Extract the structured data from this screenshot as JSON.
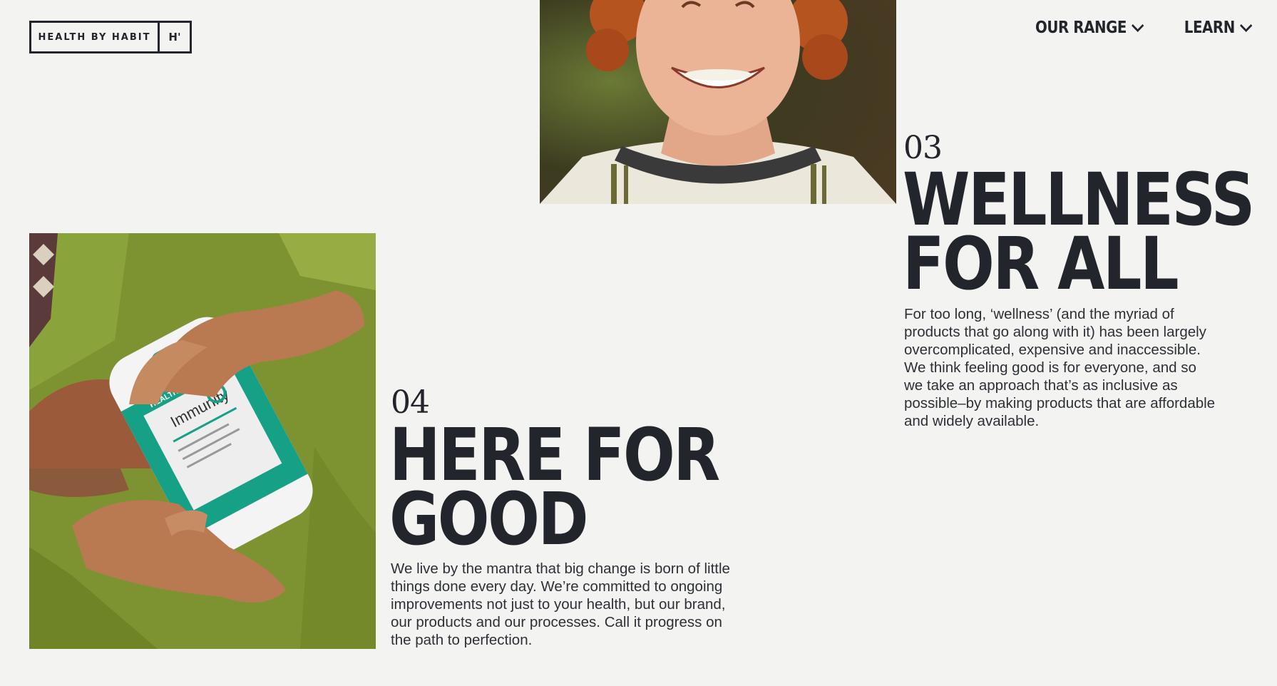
{
  "header": {
    "logo_text": "HEALTH BY HABIT",
    "logo_mark": "H'",
    "nav": [
      {
        "label": "OUR RANGE",
        "icon": "chevron-down-icon"
      },
      {
        "label": "LEARN",
        "icon": "chevron-down-icon"
      }
    ]
  },
  "sections": [
    {
      "number": "03",
      "title": "WELLNESS FOR ALL",
      "body": "For too long, ‘wellness’ (and the myriad of products that go along with it) has been largely overcomplicated, expensive and inaccessible. We think feeling good is for everyone, and so we take an approach that’s as inclusive as possible–by making products that are affordable and widely available."
    },
    {
      "number": "04",
      "title": "HERE FOR GOOD",
      "body": "We live by the mantra that big change is born of little things done every day. We’re committed to ongoing improvements not just to your health, but our brand, our products and our processes. Call it progress on the path to perfection."
    }
  ],
  "product": {
    "brand": "HEALTH BY HABIT",
    "name": "Immunity"
  },
  "colors": {
    "background": "#f3f3f1",
    "text": "#22252b",
    "accent_teal": "#16a085",
    "green_sweater": "#7a8f2e"
  }
}
